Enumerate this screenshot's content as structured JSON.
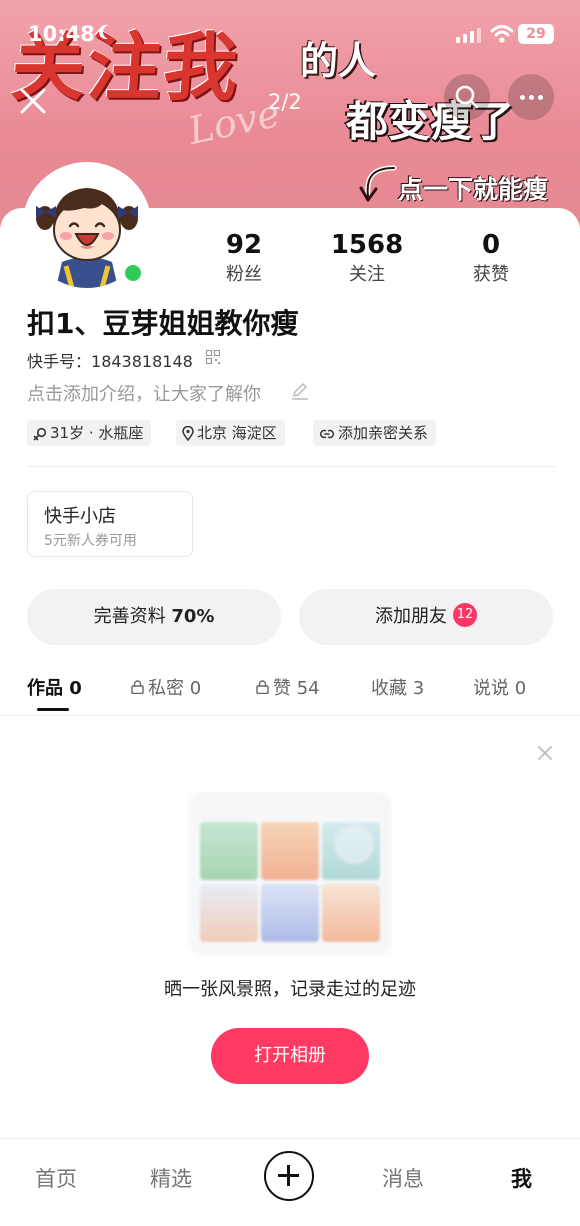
{
  "status_bar": {
    "time": "10:48",
    "battery": "29"
  },
  "banner": {
    "big_text": "关注我",
    "de_text": "的人",
    "slogan": "都变瘦了",
    "hint": "点一下就能瘦",
    "love": "Love"
  },
  "top_nav": {
    "page_indicator": "2/2"
  },
  "stats": [
    {
      "num": "92",
      "label": "粉丝"
    },
    {
      "num": "1568",
      "label": "关注"
    },
    {
      "num": "0",
      "label": "获赞"
    }
  ],
  "profile": {
    "nickname": "扣1、豆芽姐姐教你瘦",
    "id_label": "快手号：",
    "id_value": "1843818148",
    "bio_placeholder": "点击添加介绍，让大家了解你"
  },
  "tags": {
    "age": "31岁 · 水瓶座",
    "location": "北京 海淀区",
    "relation": "添加亲密关系"
  },
  "shop": {
    "title": "快手小店",
    "subtitle": "5元新人券可用"
  },
  "actions": {
    "complete_profile": "完善资料",
    "complete_percent": "70%",
    "add_friends": "添加朋友",
    "add_friends_badge": "12"
  },
  "tabs": [
    {
      "label": "作品",
      "count": "0"
    },
    {
      "label": "私密",
      "count": "0"
    },
    {
      "label": "赞",
      "count": "54"
    },
    {
      "label": "收藏",
      "count": "3"
    },
    {
      "label": "说说",
      "count": "0"
    }
  ],
  "empty_state": {
    "text": "晒一张风景照，记录走过的足迹",
    "button": "打开相册"
  },
  "bottom_nav": {
    "home": "首页",
    "featured": "精选",
    "messages": "消息",
    "me": "我"
  },
  "colors": {
    "accent": "#fe3a62",
    "badge": "#fe3666",
    "online": "#2ecc55",
    "banner": "#e98a95"
  }
}
